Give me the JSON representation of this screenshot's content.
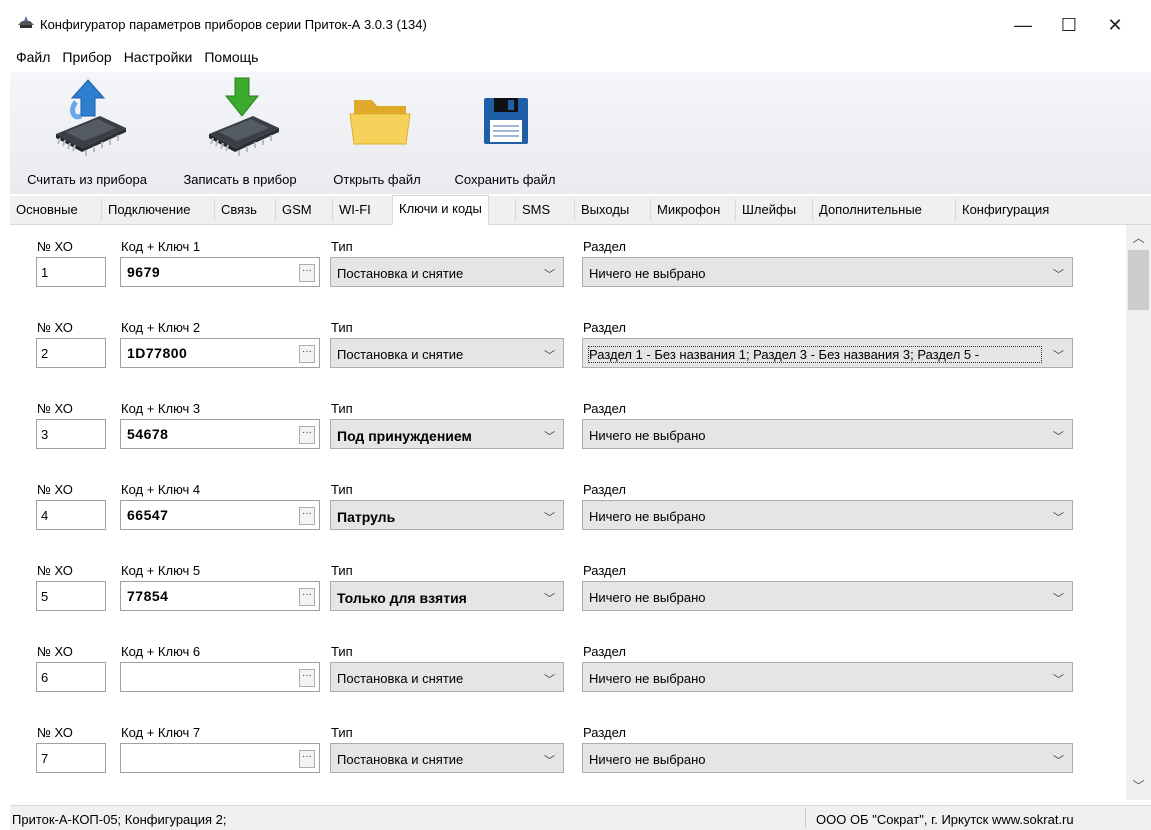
{
  "window": {
    "title": "Конфигуратор параметров приборов серии Приток-А  3.0.3 (134)",
    "minimize": "—",
    "maximize": "☐",
    "close": "✕"
  },
  "menu": [
    "Файл",
    "Прибор",
    "Настройки",
    "Помощь"
  ],
  "toolbar": {
    "read": "Считать из прибора",
    "write": "Записать в прибор",
    "open": "Открыть файл",
    "save": "Сохранить файл"
  },
  "tabs": [
    "Основные",
    "Подключение",
    "Связь",
    "GSM",
    "WI-FI",
    "Ключи и коды",
    "SMS",
    "Выходы",
    "Микрофон",
    "Шлейфы",
    "Дополнительные",
    "Конфигурация"
  ],
  "active_tab": "Ключи и коды",
  "labels": {
    "num": "№ ХО",
    "type": "Тип",
    "section": "Раздел",
    "ellipsis": "···"
  },
  "rows": [
    {
      "num": "1",
      "code_label": "Код + Ключ 1",
      "code": "9679",
      "type": "Постановка и снятие",
      "type_bold": false,
      "section": "Ничего не выбрано"
    },
    {
      "num": "2",
      "code_label": "Код + Ключ 2",
      "code": "1D77800",
      "type": "Постановка и снятие",
      "type_bold": false,
      "section": "Раздел 1 - Без названия 1; Раздел 3 - Без названия 3; Раздел 5 -"
    },
    {
      "num": "3",
      "code_label": "Код + Ключ 3",
      "code": "54678",
      "type": "Под принуждением",
      "type_bold": true,
      "section": "Ничего не выбрано"
    },
    {
      "num": "4",
      "code_label": "Код + Ключ 4",
      "code": "66547",
      "type": "Патруль",
      "type_bold": true,
      "section": "Ничего не выбрано"
    },
    {
      "num": "5",
      "code_label": "Код + Ключ 5",
      "code": "77854",
      "type": "Только для взятия",
      "type_bold": true,
      "section": "Ничего не выбрано"
    },
    {
      "num": "6",
      "code_label": "Код + Ключ 6",
      "code": "",
      "type": "Постановка и снятие",
      "type_bold": false,
      "section": "Ничего не выбрано"
    },
    {
      "num": "7",
      "code_label": "Код + Ключ 7",
      "code": "",
      "type": "Постановка и снятие",
      "type_bold": false,
      "section": "Ничего не выбрано"
    }
  ],
  "status": {
    "left": "Приток-А-КОП-05; Конфигурация 2;",
    "right": "ООО ОБ \"Сократ\", г. Иркутск   www.sokrat.ru"
  },
  "colors": {
    "arrow_blue": "#2f7fd0",
    "arrow_green": "#3caa2c",
    "folder_yellow": "#f2c842",
    "floppy_blue": "#1f5fa8"
  },
  "icons": {
    "read": "chip-upload-icon",
    "write": "chip-download-icon",
    "open": "folder-icon",
    "save": "floppy-disk-icon",
    "dropdown": "chevron-down-icon"
  }
}
